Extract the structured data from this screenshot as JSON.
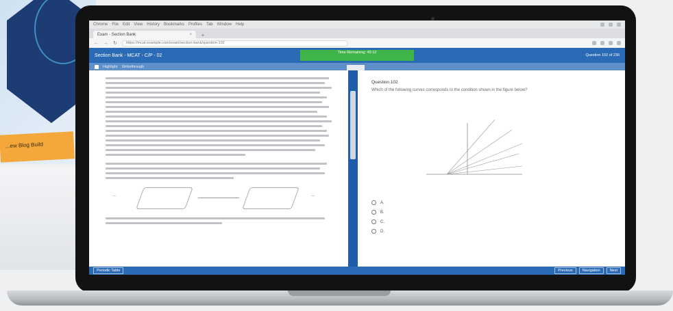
{
  "background": {
    "orange_label": "...ew Blog Build"
  },
  "browser": {
    "menu_items": [
      "Chrome",
      "File",
      "Edit",
      "View",
      "History",
      "Bookmarks",
      "Profiles",
      "Tab",
      "Window",
      "Help"
    ],
    "tab_title": "Exam - Section Bank",
    "url": "https://mcat.example.com/exam/section-bank/question-102"
  },
  "exam": {
    "title": "Section Bank - MCAT - C/P - 02",
    "timer_line1": "Time Remaining: 45:12",
    "timer_line2": "",
    "header_right_line1": "Question 102 of 230",
    "header_right_line2": "",
    "toolbar_highlight": "Highlight",
    "toolbar_strike": "Strikethrough",
    "toolbar_right": "",
    "split_label": "",
    "passage_subhead": "",
    "question_number": "Question 102",
    "question_stem": "Which of the following curves corresponds to the condition shown in the figure below?",
    "graph_label_1": "",
    "graph_label_2": "",
    "graph_label_3": "",
    "graph_label_4": "",
    "graph_label_5": "",
    "graph_axis": "",
    "choices": [
      "A.",
      "B.",
      "C.",
      "D."
    ],
    "footer_left": "Periodic Table",
    "footer_btn_previous": "Previous",
    "footer_btn_navigation": "Navigation",
    "footer_btn_next": "Next"
  }
}
